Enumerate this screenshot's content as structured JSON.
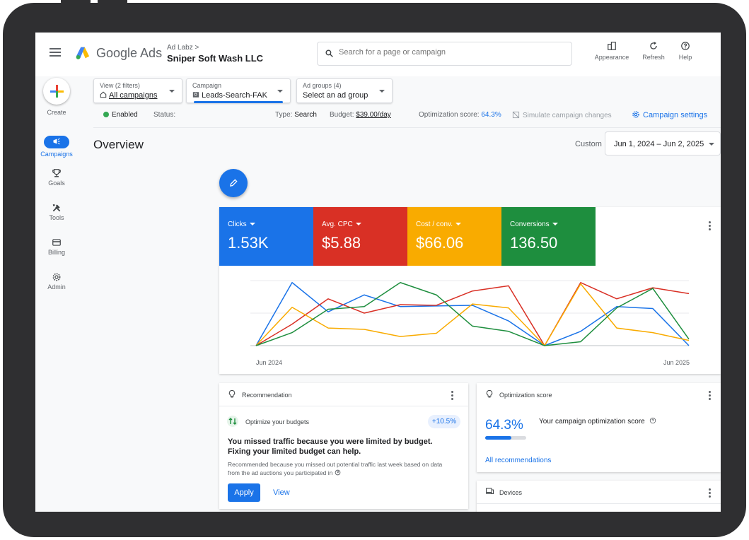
{
  "header": {
    "brand": "Google Ads",
    "account_parent": "Ad Labz",
    "account_name": "Sniper Soft Wash LLC",
    "search_placeholder": "Search for a page or campaign",
    "tools": [
      {
        "label": "Appearance",
        "icon": "appearance-icon"
      },
      {
        "label": "Refresh",
        "icon": "refresh-icon"
      },
      {
        "label": "Help",
        "icon": "help-icon"
      }
    ]
  },
  "rail": {
    "create_label": "Create",
    "items": [
      {
        "label": "Campaigns",
        "icon": "campaigns-icon",
        "active": true
      },
      {
        "label": "Goals",
        "icon": "trophy-icon"
      },
      {
        "label": "Tools",
        "icon": "tools-icon"
      },
      {
        "label": "Billing",
        "icon": "billing-icon"
      },
      {
        "label": "Admin",
        "icon": "gear-icon"
      }
    ]
  },
  "filters": {
    "view": {
      "label": "View (2 filters)",
      "value": "All campaigns"
    },
    "campaign": {
      "label": "Campaign",
      "value": "Leads-Search-FAK"
    },
    "ad_groups": {
      "label": "Ad groups (4)",
      "value": "Select an ad group"
    }
  },
  "status_row": {
    "enabled": "Enabled",
    "status_label": "Status:",
    "type_label": "Type:",
    "type_value": "Search",
    "budget_label": "Budget:",
    "budget_value": "$39.00/day",
    "optimization_label": "Optimization score:",
    "optimization_value": "64.3%",
    "simulate": "Simulate campaign changes",
    "settings": "Campaign settings"
  },
  "overview": {
    "title": "Overview",
    "custom_label": "Custom",
    "date_range": "Jun 1, 2024 – Jun 2, 2025"
  },
  "metrics": [
    {
      "label": "Clicks",
      "value": "1.53K",
      "color": "#1a73e8"
    },
    {
      "label": "Avg. CPC",
      "value": "$5.88",
      "color": "#d93025"
    },
    {
      "label": "Cost / conv.",
      "value": "$66.06",
      "color": "#f9ab00"
    },
    {
      "label": "Conversions",
      "value": "136.50",
      "color": "#1e8e3e"
    }
  ],
  "chart_data": {
    "type": "line",
    "x": [
      0,
      1,
      2,
      3,
      4,
      5,
      6,
      7,
      8,
      9,
      10,
      11,
      12
    ],
    "x_tick_labels": [
      "Jun 2024",
      "Jun 2025"
    ],
    "ylim": [
      0,
      100
    ],
    "grid": true,
    "series": [
      {
        "color": "#1a73e8",
        "values": [
          0,
          97,
          52,
          78,
          60,
          61,
          62,
          38,
          0,
          22,
          60,
          57,
          0
        ]
      },
      {
        "color": "#d93025",
        "values": [
          0,
          33,
          72,
          50,
          63,
          62,
          84,
          92,
          0,
          97,
          72,
          89,
          80
        ]
      },
      {
        "color": "#f9ab00",
        "values": [
          0,
          59,
          27,
          25,
          14,
          19,
          64,
          58,
          0,
          95,
          27,
          20,
          8
        ]
      },
      {
        "color": "#1e8e3e",
        "values": [
          0,
          20,
          56,
          60,
          97,
          78,
          30,
          22,
          0,
          6,
          58,
          88,
          10
        ]
      }
    ]
  },
  "recommendation": {
    "title": "Recommendation",
    "item": "Optimize your budgets",
    "badge": "+10.5%",
    "headline": "You missed traffic because you were limited by budget. Fixing your limited budget can help.",
    "body": "Recommended because you missed out potential traffic last week based on data from the ad auctions you participated in",
    "apply": "Apply",
    "view": "View"
  },
  "optimization": {
    "title": "Optimization score",
    "value": "64.3%",
    "progress": 0.643,
    "description": "Your campaign optimization score",
    "link": "All recommendations"
  },
  "devices": {
    "title": "Devices"
  }
}
